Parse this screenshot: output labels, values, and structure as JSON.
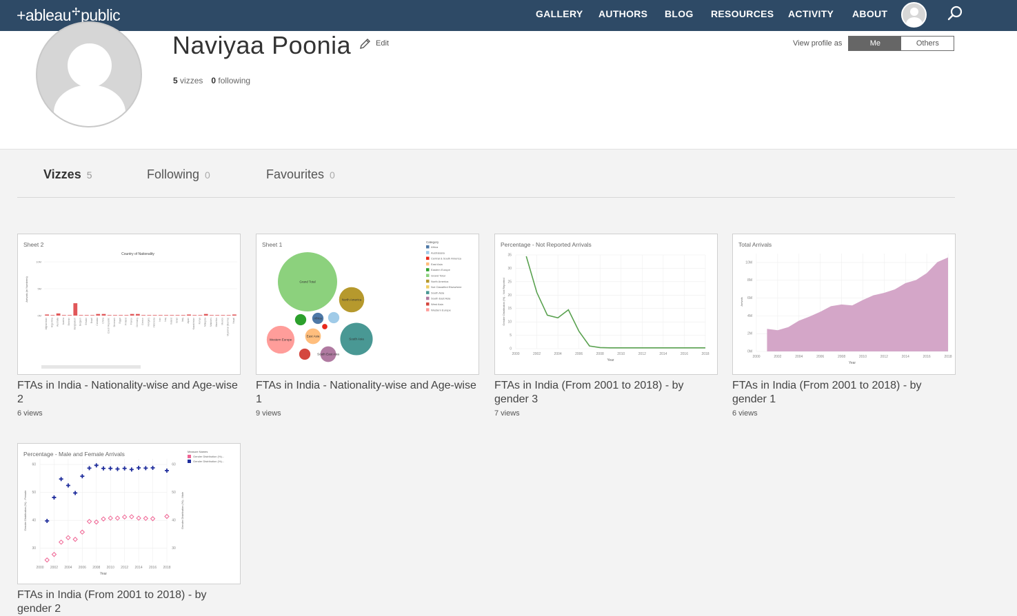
{
  "brand": {
    "name": "+ableau",
    "suffix": "public"
  },
  "nav": {
    "items": [
      "GALLERY",
      "AUTHORS",
      "BLOG",
      "RESOURCES",
      "ACTIVITY",
      "ABOUT"
    ]
  },
  "profile": {
    "name": "Naviyaa Poonia",
    "edit_label": "Edit",
    "vizzes_count": "5",
    "vizzes_label": "vizzes",
    "following_count": "0",
    "following_label": "following",
    "view_as_label": "View profile as",
    "view_as_options": [
      "Me",
      "Others"
    ],
    "view_as_selected": "Me"
  },
  "tabs": [
    {
      "label": "Vizzes",
      "count": "5"
    },
    {
      "label": "Following",
      "count": "0"
    },
    {
      "label": "Favourites",
      "count": "0"
    }
  ],
  "vizzes": [
    {
      "title": "FTAs in India - Nationality-wise and Age-wise 2",
      "views": "6 views",
      "sheet": "Sheet 2",
      "chart_data": {
        "type": "bar",
        "title": "Country of Nationality",
        "ylabel": "Arrivals (in Numbers)",
        "y_ticks": [
          "10M",
          "5M",
          "0M"
        ],
        "ylim": [
          0,
          10
        ],
        "categories": [
          "Afghanistan",
          "Argentina",
          "Australia",
          "Austria",
          "Bahrain",
          "Bangladesh",
          "Belgium",
          "Bhutan",
          "Brazil",
          "Canada",
          "China",
          "Czech Republic",
          "Denmark",
          "Egypt",
          "Finland",
          "France",
          "Germany",
          "Greece",
          "Hungary",
          "Indonesia",
          "Iran",
          "Iraq",
          "Ireland",
          "Israel",
          "Italy",
          "Japan",
          "Kazakhstan",
          "Kenya",
          "Malaysia",
          "Maldives",
          "Mauritius",
          "Mexico",
          "Myanmar (Burma)",
          "Nepal"
        ],
        "values": [
          0.2,
          0.1,
          0.4,
          0.1,
          0.1,
          2.3,
          0.1,
          0.1,
          0.1,
          0.3,
          0.3,
          0.1,
          0.1,
          0.1,
          0.1,
          0.3,
          0.3,
          0.1,
          0.1,
          0.1,
          0.1,
          0.1,
          0.1,
          0.1,
          0.1,
          0.2,
          0.1,
          0.1,
          0.3,
          0.1,
          0.1,
          0.1,
          0.1,
          0.2
        ],
        "color": "#e15759"
      }
    },
    {
      "title": "FTAs in India - Nationality-wise and Age-wise 1",
      "views": "9 views",
      "sheet": "Sheet 1",
      "chart_data": {
        "type": "bubble",
        "legend_title": "Category",
        "legend": [
          {
            "name": "Africa",
            "color": "#4e79a7"
          },
          {
            "name": "Australasia",
            "color": "#a0cbe8"
          },
          {
            "name": "Central & South America",
            "color": "#e8291c"
          },
          {
            "name": "East Asia",
            "color": "#ffbe7d"
          },
          {
            "name": "Eastern Europe",
            "color": "#2ca02c"
          },
          {
            "name": "Grand Total",
            "color": "#8cd17d"
          },
          {
            "name": "North America",
            "color": "#b6992d"
          },
          {
            "name": "Not Classified Elsewhere",
            "color": "#f1ce63"
          },
          {
            "name": "South Asia",
            "color": "#499894"
          },
          {
            "name": "South East Asia",
            "color": "#b07aa1"
          },
          {
            "name": "West Asia",
            "color": "#d4473f"
          },
          {
            "name": "Western Europe",
            "color": "#ff9d9a"
          }
        ],
        "bubbles": [
          {
            "label": "Grand Total",
            "value": 100,
            "color": "#8cd17d"
          },
          {
            "label": "North America",
            "value": 18,
            "color": "#b6992d"
          },
          {
            "label": "South Asia",
            "value": 30,
            "color": "#499894"
          },
          {
            "label": "Western Europe",
            "value": 22,
            "color": "#ff9d9a"
          },
          {
            "label": "East Asia",
            "value": 7,
            "color": "#ffbe7d"
          },
          {
            "label": "South East Asia",
            "value": 7,
            "color": "#b07aa1"
          },
          {
            "label": "Africa",
            "value": 3.6,
            "color": "#4e79a7"
          },
          {
            "label": "",
            "value": 3.6,
            "color": "#2ca02c"
          },
          {
            "label": "",
            "value": 3.6,
            "color": "#a0cbe8"
          },
          {
            "label": "",
            "value": 3.6,
            "color": "#d4473f"
          },
          {
            "label": "",
            "value": 0.8,
            "color": "#e8291c"
          }
        ]
      }
    },
    {
      "title": "FTAs in India (From 2001 to 2018) - by gender 3",
      "views": "7 views",
      "sheet": "Percentage - Not Reported Arrivals",
      "chart_data": {
        "type": "line",
        "xlabel": "Year",
        "ylabel": "Gender Distribution (%) - Not Reported",
        "x": [
          2001,
          2002,
          2003,
          2004,
          2005,
          2006,
          2007,
          2008,
          2009,
          2010,
          2011,
          2012,
          2013,
          2014,
          2015,
          2016,
          2017,
          2018
        ],
        "values": [
          34.5,
          21,
          12.5,
          11.5,
          14.5,
          6.5,
          1,
          0.4,
          0.3,
          0.3,
          0.3,
          0.3,
          0.3,
          0.3,
          0.3,
          0.3,
          0.3,
          0.3
        ],
        "x_ticks": [
          2000,
          2002,
          2004,
          2006,
          2008,
          2010,
          2012,
          2014,
          2016,
          2018
        ],
        "y_ticks": [
          0,
          5,
          10,
          15,
          20,
          25,
          30,
          35
        ],
        "xlim": [
          2000,
          2018
        ],
        "ylim": [
          0,
          35
        ],
        "color": "#59a14f"
      }
    },
    {
      "title": "FTAs in India (From 2001 to 2018) - by gender 1",
      "views": "6 views",
      "sheet": "Total Arrivals",
      "chart_data": {
        "type": "area",
        "xlabel": "Year",
        "ylabel": "Arrivals",
        "x": [
          2001,
          2002,
          2003,
          2004,
          2005,
          2006,
          2007,
          2008,
          2009,
          2010,
          2011,
          2012,
          2013,
          2014,
          2015,
          2016,
          2017,
          2018
        ],
        "values": [
          2.54,
          2.38,
          2.73,
          3.46,
          3.92,
          4.45,
          5.08,
          5.28,
          5.17,
          5.78,
          6.31,
          6.58,
          6.97,
          7.68,
          8.03,
          8.8,
          10.04,
          10.56
        ],
        "x_ticks": [
          2000,
          2002,
          2004,
          2006,
          2008,
          2010,
          2012,
          2014,
          2016,
          2018
        ],
        "y_ticks": [
          "0M",
          "2M",
          "4M",
          "6M",
          "8M",
          "10M"
        ],
        "xlim": [
          2000,
          2018
        ],
        "ylim": [
          0,
          11
        ],
        "color": "#d4a6c8"
      }
    },
    {
      "title": "FTAs in India (From 2001 to 2018) - by gender 2",
      "views": "",
      "sheet": "Percentage - Male and Female Arrivals",
      "chart_data": {
        "type": "scatter",
        "xlabel": "Year",
        "ylabel": "Gender Distribution (%) - Female",
        "ylabel_right": "Gender Distribution (%) - Male",
        "legend_title": "Measure Names",
        "series": [
          {
            "name": "Gender Distribution (%)...",
            "color": "#f06292",
            "marker": "diamond",
            "values": [
              25.8,
              27.8,
              32.2,
              33.8,
              33.2,
              35.8,
              39.6,
              39.4,
              40.5,
              40.8,
              40.8,
              41.2,
              41.3,
              40.8,
              40.7,
              40.6,
              41.4
            ]
          },
          {
            "name": "Gender Distribution (%)...",
            "color": "#1f2d9c",
            "marker": "cross",
            "values": [
              39.8,
              48.2,
              54.8,
              52.5,
              49.8,
              55.8,
              58.7,
              59.7,
              58.6,
              58.6,
              58.4,
              58.6,
              58.2,
              58.8,
              58.7,
              58.8,
              57.8
            ]
          }
        ],
        "x": [
          2001,
          2002,
          2003,
          2004,
          2005,
          2006,
          2007,
          2008,
          2009,
          2010,
          2011,
          2012,
          2013,
          2014,
          2015,
          2016,
          2018
        ],
        "x_ticks": [
          2000,
          2002,
          2004,
          2006,
          2008,
          2010,
          2012,
          2014,
          2016,
          2018
        ],
        "y_ticks": [
          30,
          40,
          50,
          60
        ],
        "xlim": [
          2000,
          2018
        ],
        "ylim": [
          25,
          62
        ]
      }
    }
  ]
}
